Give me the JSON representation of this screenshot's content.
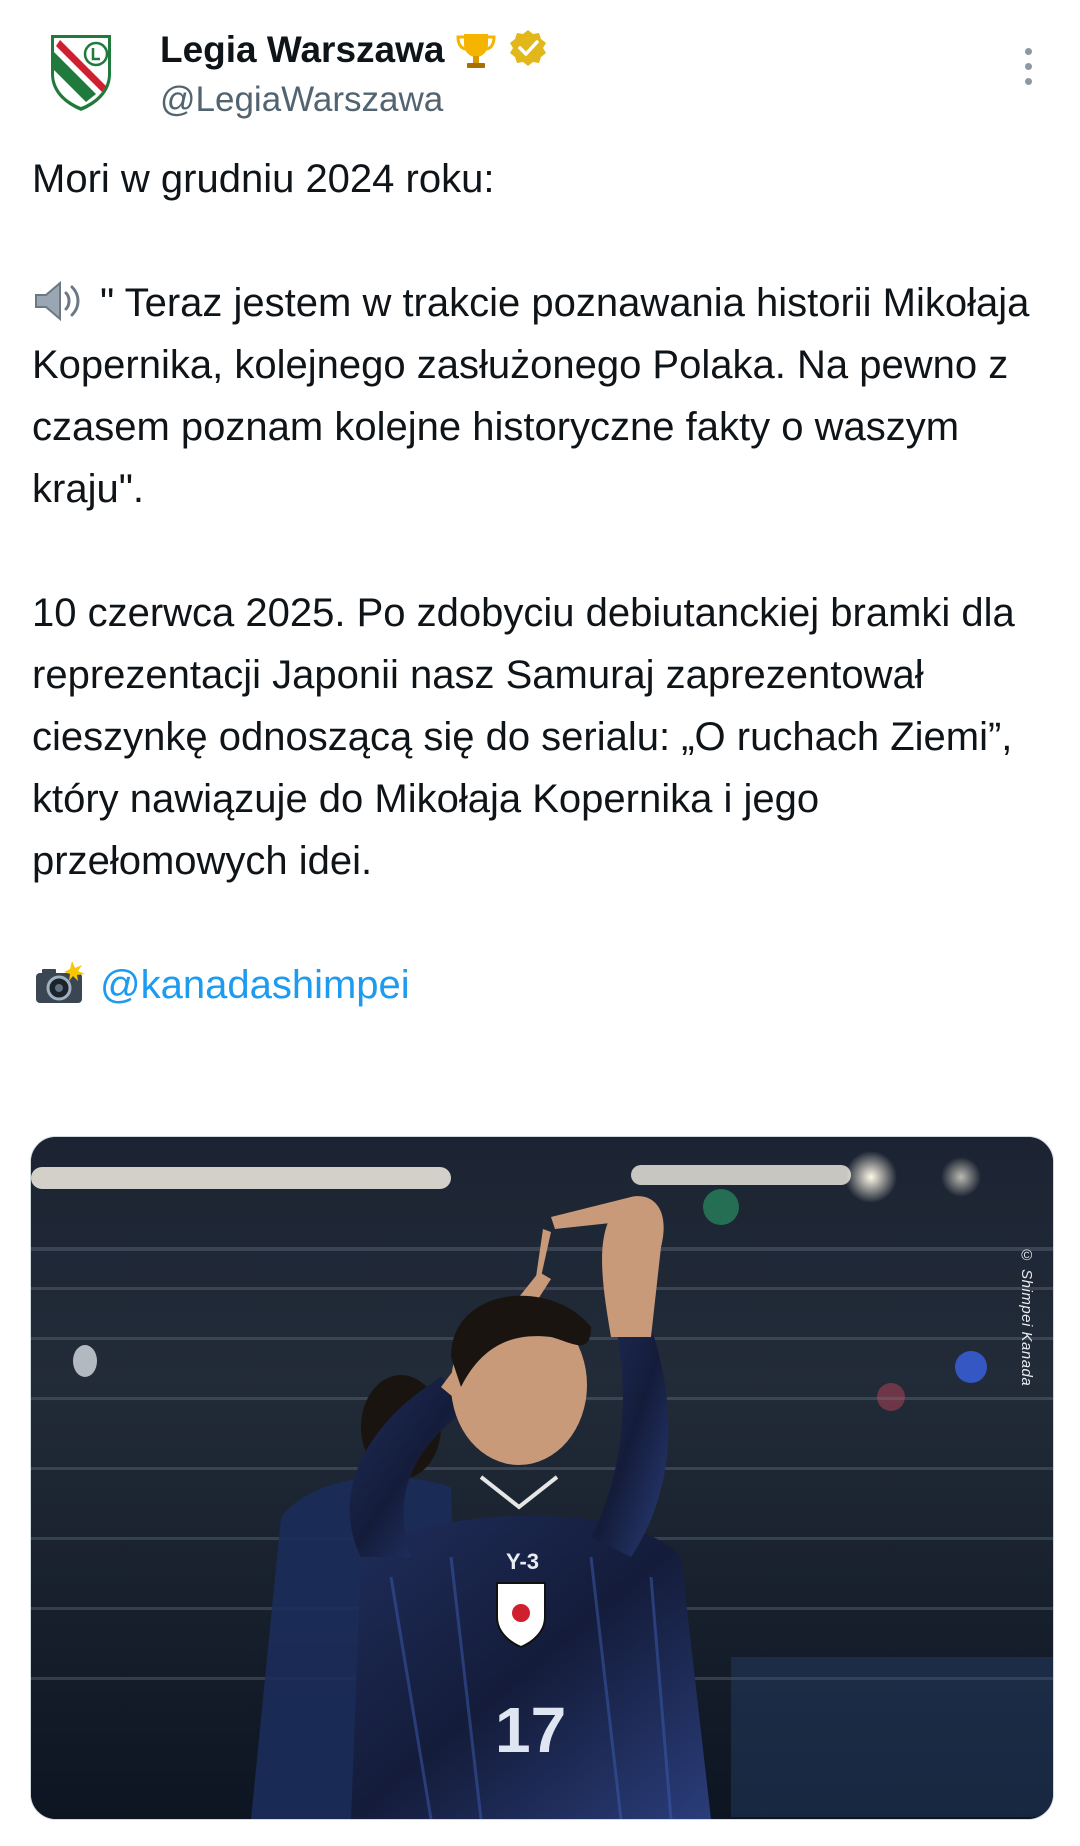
{
  "account": {
    "display_name": "Legia Warszawa",
    "handle": "@LegiaWarszawa",
    "badges": [
      "trophy-emoji",
      "verified-gold-badge"
    ]
  },
  "tweet": {
    "line1": "Mori w grudniu 2024 roku:",
    "quote": "\" Teraz jestem w trakcie poznawania historii Mikołaja Kopernika, kolejnego zasłużonego Polaka. Na pewno z czasem poznam kolejne historyczne fakty o waszym kraju\".",
    "paragraph2": "10 czerwca 2025. Po zdobyciu debiutanckiej bramki dla reprezentacji Japonii nasz Samuraj zaprezentował cieszynkę odnoszącą się do serialu: „O ruchach Ziemi”, który nawiązuje do Mikołaja Kopernika i jego przełomowych idei.",
    "photo_credit_mention": "@kanadashimpei"
  },
  "media": {
    "watermark": "© Shimpei Kanada",
    "jersey_brand": "Y-3",
    "jersey_number": "17"
  },
  "colors": {
    "text": "#0f1419",
    "secondary": "#536471",
    "link": "#1d9bf0",
    "legia_green": "#1f7a3b",
    "legia_red": "#d0202f",
    "jersey_navy": "#141c3a"
  }
}
